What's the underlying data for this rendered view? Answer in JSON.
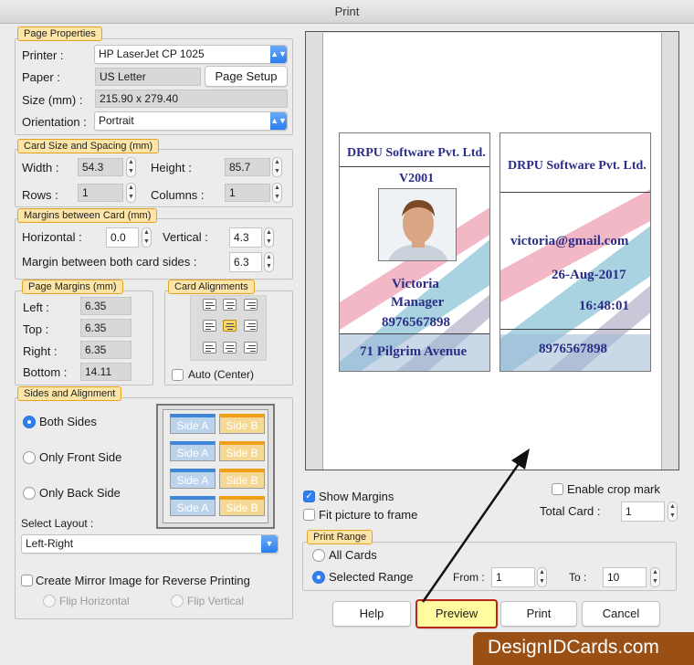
{
  "window": {
    "title": "Print"
  },
  "page_properties": {
    "legend": "Page Properties",
    "printer_label": "Printer :",
    "printer_value": "HP LaserJet CP 1025",
    "paper_label": "Paper :",
    "paper_value": "US Letter",
    "page_setup": "Page Setup",
    "size_label": "Size (mm) :",
    "size_value": "215.90 x 279.40",
    "orientation_label": "Orientation :",
    "orientation_value": "Portrait"
  },
  "card_size": {
    "legend": "Card Size and Spacing (mm)",
    "width_label": "Width :",
    "width_value": "54.3",
    "height_label": "Height :",
    "height_value": "85.7",
    "rows_label": "Rows :",
    "rows_value": "1",
    "columns_label": "Columns :",
    "columns_value": "1"
  },
  "margins_card": {
    "legend": "Margins between Card (mm)",
    "horizontal_label": "Horizontal :",
    "horizontal_value": "0.0",
    "vertical_label": "Vertical :",
    "vertical_value": "4.3",
    "both_label": "Margin between both card sides :",
    "both_value": "6.3"
  },
  "page_margins": {
    "legend": "Page Margins (mm)",
    "left_label": "Left :",
    "left_value": "6.35",
    "top_label": "Top :",
    "top_value": "6.35",
    "right_label": "Right :",
    "right_value": "6.35",
    "bottom_label": "Bottom :",
    "bottom_value": "14.11"
  },
  "card_alignments": {
    "legend": "Card Alignments",
    "auto_label": "Auto (Center)",
    "selected": "middle-center"
  },
  "sides": {
    "legend": "Sides and Alignment",
    "both": "Both Sides",
    "front": "Only Front Side",
    "back": "Only Back Side",
    "selected": "Both Sides",
    "side_a": "Side A",
    "side_b": "Side B",
    "layout_label": "Select Layout :",
    "layout_value": "Left-Right",
    "mirror_label": "Create Mirror Image for Reverse Printing",
    "flip_h": "Flip Horizontal",
    "flip_v": "Flip Vertical"
  },
  "preview": {
    "front": {
      "company": "DRPU Software Pvt. Ltd.",
      "id": "V2001",
      "name": "Victoria",
      "role": "Manager",
      "phone": "8976567898",
      "address": "71 Pilgrim Avenue"
    },
    "back": {
      "company": "DRPU Software Pvt. Ltd.",
      "email": "victoria@gmail.com",
      "date": "26-Aug-2017",
      "time": "16:48:01",
      "phone": "8976567898"
    }
  },
  "options": {
    "show_margins": "Show Margins",
    "show_margins_checked": true,
    "fit_picture": "Fit picture to frame",
    "fit_picture_checked": false,
    "crop_mark": "Enable crop mark",
    "crop_mark_checked": false,
    "total_card_label": "Total Card :",
    "total_card_value": "1"
  },
  "print_range": {
    "legend": "Print Range",
    "all": "All Cards",
    "selected_range": "Selected Range",
    "selected": "Selected Range",
    "from_label": "From :",
    "from_value": "1",
    "to_label": "To :",
    "to_value": "10"
  },
  "buttons": {
    "help": "Help",
    "preview": "Preview",
    "print": "Print",
    "cancel": "Cancel"
  },
  "watermark": "DesignIDCards.com",
  "colors": {
    "legend_fill": "#fde5a8",
    "legend_border": "#e8a020",
    "accent": "#2f7ff0",
    "card_text": "#2b2d86",
    "watermark_bg": "#9a4f14"
  }
}
